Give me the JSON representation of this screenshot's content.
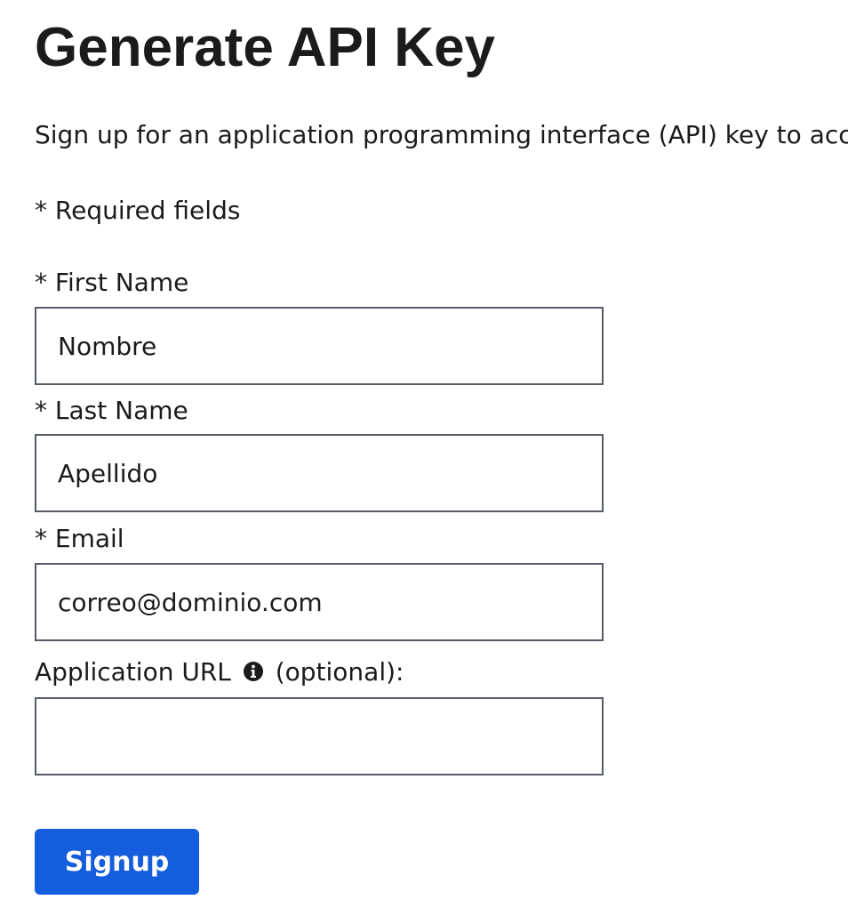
{
  "page": {
    "title": "Generate API Key",
    "intro": "Sign up for an application programming interface (API) key to acc",
    "required_note": "* Required fields"
  },
  "form": {
    "first_name": {
      "label": "* First Name",
      "placeholder": "Nombre",
      "value": ""
    },
    "last_name": {
      "label": "* Last Name",
      "placeholder": "Apellido",
      "value": ""
    },
    "email": {
      "label": "* Email",
      "placeholder": "correo@dominio.com",
      "value": ""
    },
    "application_url": {
      "label_prefix": "Application URL",
      "label_suffix": "(optional):",
      "info_icon": "info-circle-icon",
      "placeholder": "",
      "value": ""
    },
    "submit_label": "Signup"
  },
  "colors": {
    "text": "#1b1b1b",
    "input_border": "#565c65",
    "button_bg": "#145ddc",
    "button_text": "#ffffff"
  }
}
